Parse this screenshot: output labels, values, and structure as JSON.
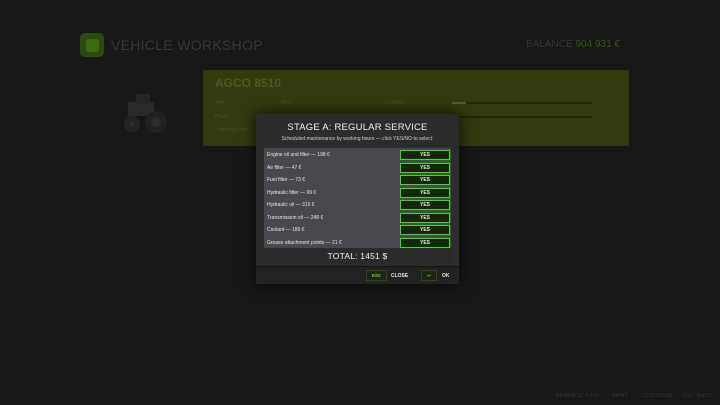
{
  "header": {
    "title": "VEHICLE WORKSHOP",
    "balance_label": "BALANCE",
    "balance_value": "904 931 €"
  },
  "vehicle": {
    "name": "AGCO 8510",
    "rows": [
      {
        "label": "Age",
        "value": "8510"
      },
      {
        "label": "Hours",
        "value": ""
      },
      {
        "label": "Operating Time",
        "value": ""
      }
    ],
    "condition_label": "Condition",
    "condition_fill": 0.1
  },
  "modal": {
    "title": "STAGE A: REGULAR SERVICE",
    "subtitle": "Scheduled maintenance by working hours — click YES/NO to select:",
    "items": [
      {
        "label": "Engine oil and filter — 198 €",
        "choice": "YES"
      },
      {
        "label": "Air filter — 47 €",
        "choice": "YES"
      },
      {
        "label": "Fuel filter — 73 €",
        "choice": "YES"
      },
      {
        "label": "Hydraulic filter — 99 €",
        "choice": "YES"
      },
      {
        "label": "Hydraulic oil — 315 €",
        "choice": "YES"
      },
      {
        "label": "Transmission oil — 248 €",
        "choice": "YES"
      },
      {
        "label": "Coolant — 186 €",
        "choice": "YES"
      },
      {
        "label": "Grease attachment points — 21 €",
        "choice": "YES"
      }
    ],
    "total": "TOTAL: 1451 $",
    "footer": {
      "close_key": "ESC",
      "close_label": "CLOSE",
      "ok_key": "↩",
      "ok_label": "OK"
    }
  },
  "bottom_bar": [
    {
      "key": "",
      "label": "REPAIR IC 4,500"
    },
    {
      "key": "",
      "label": "PAINT"
    },
    {
      "key": "",
      "label": "CUSTOMIZE"
    },
    {
      "key": "ESC",
      "label": "BACK"
    }
  ],
  "colors": {
    "accent_green": "#39e21a",
    "modal_bg": "#2c2c2c",
    "list_bg": "#48484e"
  }
}
